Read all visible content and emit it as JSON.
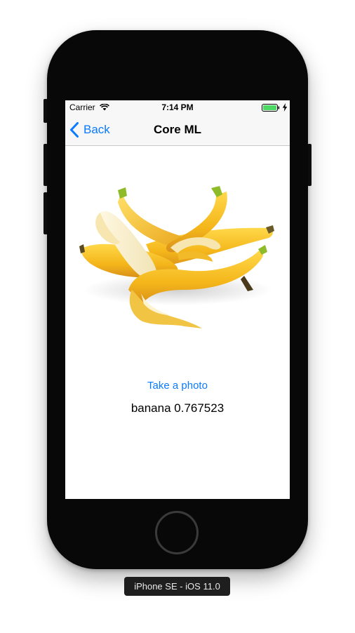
{
  "status_bar": {
    "carrier": "Carrier",
    "time": "7:14 PM",
    "wifi_icon": "wifi-icon",
    "battery_icon": "battery-icon",
    "charging_icon": "charging-bolt-icon",
    "battery_color": "#4cd964"
  },
  "nav_bar": {
    "back_label": "Back",
    "back_icon": "chevron-left-icon",
    "title": "Core ML"
  },
  "content": {
    "image_subject": "bananas",
    "take_photo_label": "Take a photo",
    "result_text": "banana 0.767523"
  },
  "device_label": "iPhone SE - iOS 11.0",
  "colors": {
    "accent": "#0a7aff",
    "phone_body": "#080808"
  }
}
